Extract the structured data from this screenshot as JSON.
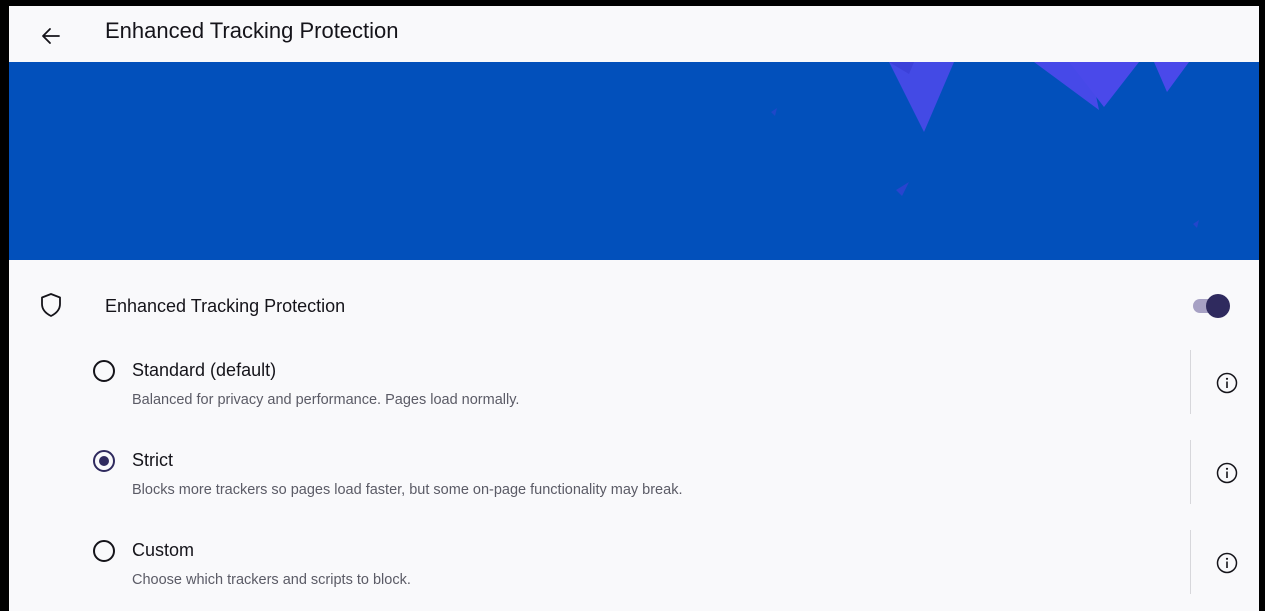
{
  "appbar": {
    "title": "Enhanced Tracking Protection",
    "back_icon": "arrow-left-icon"
  },
  "banner": {
    "background_color": "#0250bb",
    "accent_color": "#4a49ea"
  },
  "main_setting": {
    "icon": "shield-icon",
    "label": "Enhanced Tracking Protection",
    "enabled": true
  },
  "options": [
    {
      "title": "Standard (default)",
      "description": "Balanced for privacy and performance. Pages load normally.",
      "selected": false,
      "info_icon": "info-icon"
    },
    {
      "title": "Strict",
      "description": "Blocks more trackers so pages load faster, but some on-page functionality may break.",
      "selected": true,
      "info_icon": "info-icon"
    },
    {
      "title": "Custom",
      "description": "Choose which trackers and scripts to block.",
      "selected": false,
      "info_icon": "info-icon"
    }
  ],
  "colors": {
    "selected_accent": "#2f2a5e",
    "text_primary": "#15141a",
    "text_secondary": "#5b5b66"
  }
}
